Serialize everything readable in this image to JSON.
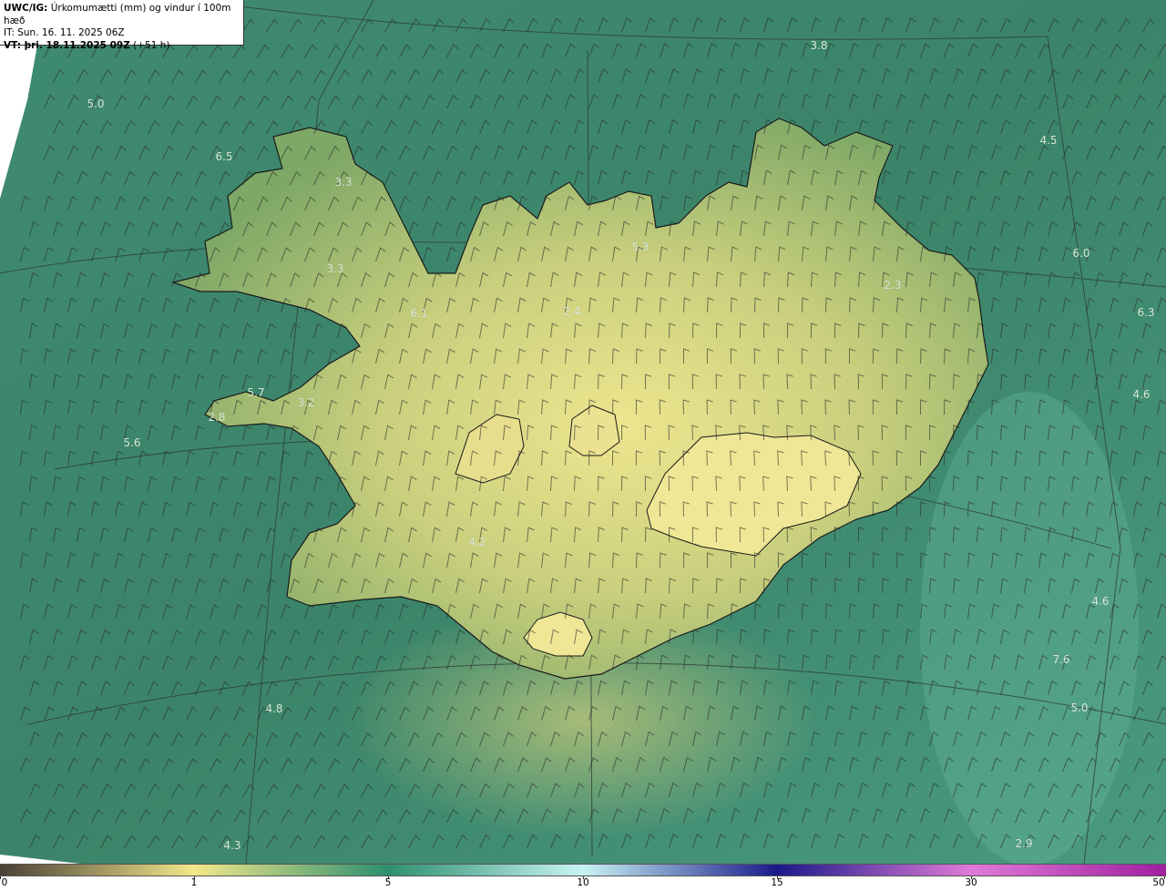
{
  "header": {
    "product": "UWC/IG:",
    "title": "Úrkomumætti (mm) og vindur í 100m hæð",
    "issue_time": "IT: Sun. 16. 11. 2025 06Z",
    "valid_label": "VT: þri. 18.11.2025 09Z",
    "valid_offset": "(+51 h)"
  },
  "map_labels": [
    "3.8",
    "5.0",
    "6.5",
    "3.3",
    "4.5",
    "5.3",
    "6.0",
    "3.3",
    "2.3",
    "6.1",
    "2.4",
    "6.3",
    "4.6",
    "5.7",
    "3.2",
    "2.8",
    "5.6",
    "4.2",
    "4.6",
    "7.6",
    "4.8",
    "5.0",
    "4.3",
    "2.9"
  ],
  "colorbar": {
    "ticks": [
      "0",
      "1",
      "5",
      "10",
      "15",
      "30",
      "50"
    ],
    "stops": [
      {
        "v": 0,
        "color": "#4a3f35"
      },
      {
        "v": 1,
        "color": "#f3e88a"
      },
      {
        "v": 5,
        "color": "#2d8f6f"
      },
      {
        "v": 10,
        "color": "#c8f4f4"
      },
      {
        "v": 15,
        "color": "#1a1a8a"
      },
      {
        "v": 30,
        "color": "#e17ad8"
      },
      {
        "v": 50,
        "color": "#a020a0"
      }
    ]
  },
  "colors": {
    "sea": "#3e8a6e",
    "land_low": "#93b86a",
    "land_high": "#e3dc8a",
    "coast": "#1a1a1a",
    "grid": "#2a3a33"
  }
}
